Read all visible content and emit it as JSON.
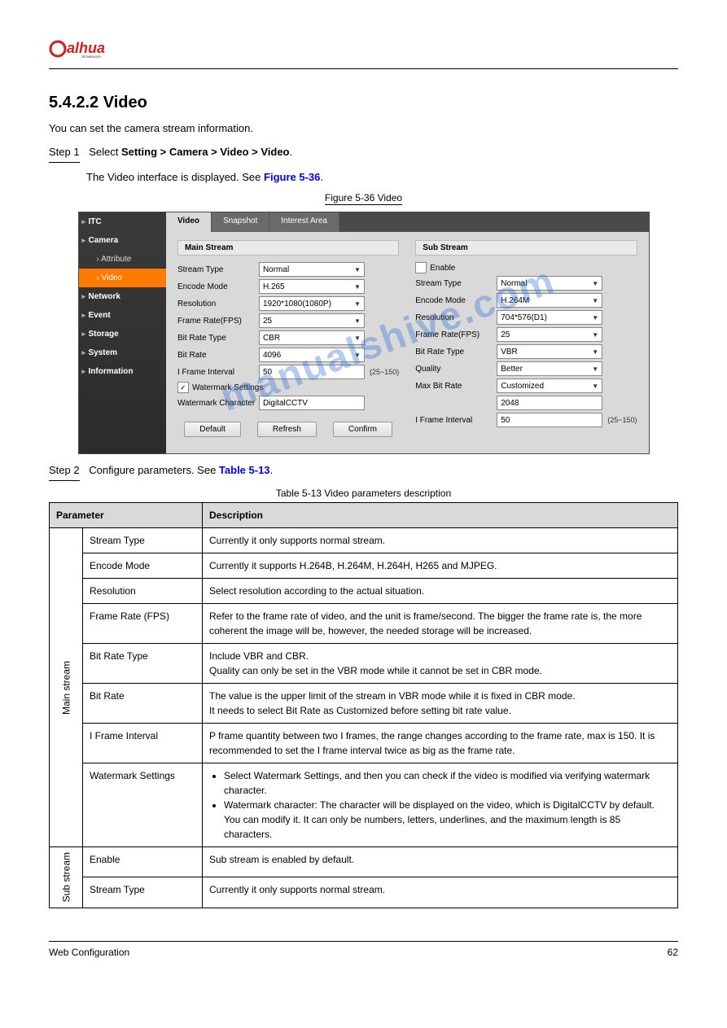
{
  "logo": {
    "brand": "alhua",
    "sub": "TECHNOLOGY"
  },
  "heading": "5.4.2.2 Video",
  "intro": "You can set the camera stream information.",
  "step1": {
    "num": "Step 1",
    "text": "Select ",
    "path": "Setting > Camera > Video > Video",
    "tail": "."
  },
  "step1b": "The Video interface is displayed. See ",
  "step1b_link": "Figure 5-36",
  "figure_caption": "Figure 5-36 Video",
  "sidebar": {
    "items": [
      {
        "label": "ITC",
        "type": "top"
      },
      {
        "label": "Camera",
        "type": "top"
      },
      {
        "label": "Attribute",
        "type": "sub"
      },
      {
        "label": "Video",
        "type": "sub",
        "active": true
      },
      {
        "label": "Network",
        "type": "top"
      },
      {
        "label": "Event",
        "type": "top"
      },
      {
        "label": "Storage",
        "type": "top"
      },
      {
        "label": "System",
        "type": "top"
      },
      {
        "label": "Information",
        "type": "top"
      }
    ]
  },
  "tabs": [
    {
      "label": "Video",
      "active": true
    },
    {
      "label": "Snapshot"
    },
    {
      "label": "Interest Area"
    }
  ],
  "main_stream": {
    "title": "Main Stream",
    "stream_type_label": "Stream Type",
    "stream_type": "Normal",
    "encode_mode_label": "Encode Mode",
    "encode_mode": "H.265",
    "resolution_label": "Resolution",
    "resolution": "1920*1080(1080P)",
    "frame_rate_label": "Frame Rate(FPS)",
    "frame_rate": "25",
    "bit_rate_type_label": "Bit Rate Type",
    "bit_rate_type": "CBR",
    "bit_rate_label": "Bit Rate",
    "bit_rate": "4096",
    "iframe_label": "I Frame Interval",
    "iframe": "50",
    "iframe_range": "(25~150)",
    "wm_settings_label": "Watermark Settings",
    "wm_char_label": "Watermark Character",
    "wm_char": "DigitalCCTV"
  },
  "sub_stream": {
    "title": "Sub Stream",
    "enable_label": "Enable",
    "stream_type_label": "Stream Type",
    "stream_type": "Normal",
    "encode_mode_label": "Encode Mode",
    "encode_mode": "H.264M",
    "resolution_label": "Resolution",
    "resolution": "704*576(D1)",
    "frame_rate_label": "Frame Rate(FPS)",
    "frame_rate": "25",
    "bit_rate_type_label": "Bit Rate Type",
    "bit_rate_type": "VBR",
    "quality_label": "Quality",
    "quality": "Better",
    "max_bit_rate_label": "Max Bit Rate",
    "max_bit_rate": "Customized",
    "max_bit_rate_val": "2048",
    "iframe_label": "I Frame Interval",
    "iframe": "50",
    "iframe_range": "(25~150)"
  },
  "buttons": {
    "default": "Default",
    "refresh": "Refresh",
    "confirm": "Confirm"
  },
  "watermark_text": "manualshive.com",
  "step2": {
    "num": "Step 2",
    "text": "Configure parameters. See ",
    "link": "Table 5-13",
    "tail": "."
  },
  "table_caption": "Table 5-13 Video parameters description",
  "table": {
    "headers": [
      "Parameter",
      "Description"
    ],
    "rows": [
      {
        "group": "Main stream",
        "name": "Stream Type",
        "desc": "Currently it only supports normal stream."
      },
      {
        "group": "Main stream",
        "name": "Encode Mode",
        "desc": "Currently it supports H.264B, H.264M, H.264H, H265 and MJPEG."
      },
      {
        "group": "Main stream",
        "name": "Resolution",
        "desc": "Select resolution according to the actual situation."
      },
      {
        "group": "Main stream",
        "name": "Frame Rate (FPS)",
        "desc": "Refer to the frame rate of video, and the unit is frame/second. The bigger the frame rate is, the more coherent the image will be, however, the needed storage will be increased."
      },
      {
        "group": "Main stream",
        "name": "Bit Rate Type",
        "desc": "Include VBR and CBR.\nQuality can only be set in the VBR mode while it cannot be set in CBR mode."
      },
      {
        "group": "Main stream",
        "name": "Bit Rate",
        "desc": "The value is the upper limit of the stream in VBR mode while it is fixed in CBR mode.\nIt needs to select Bit Rate as Customized before setting bit rate value."
      },
      {
        "group": "Main stream",
        "name": "I Frame Interval",
        "desc": "P frame quantity between two I frames, the range changes according to the frame rate, max is 150. It is recommended to set the I frame interval twice as big as the frame rate."
      },
      {
        "group": "Main stream",
        "name": "Watermark Settings",
        "desc_list": [
          "Select Watermark Settings, and then you can check if the video is modified via verifying watermark character.",
          "Watermark character: The character will be displayed on the video, which is DigitalCCTV by default. You can modify it. It can only be numbers, letters, underlines, and the maximum length is 85 characters."
        ]
      },
      {
        "group": "Sub stream",
        "name": "Enable",
        "desc": "Sub stream is enabled by default."
      },
      {
        "group": "Sub stream",
        "name": "Stream Type",
        "desc": "Currently it only supports normal stream."
      }
    ]
  },
  "footer": {
    "left": "Web Configuration",
    "right": "62"
  }
}
